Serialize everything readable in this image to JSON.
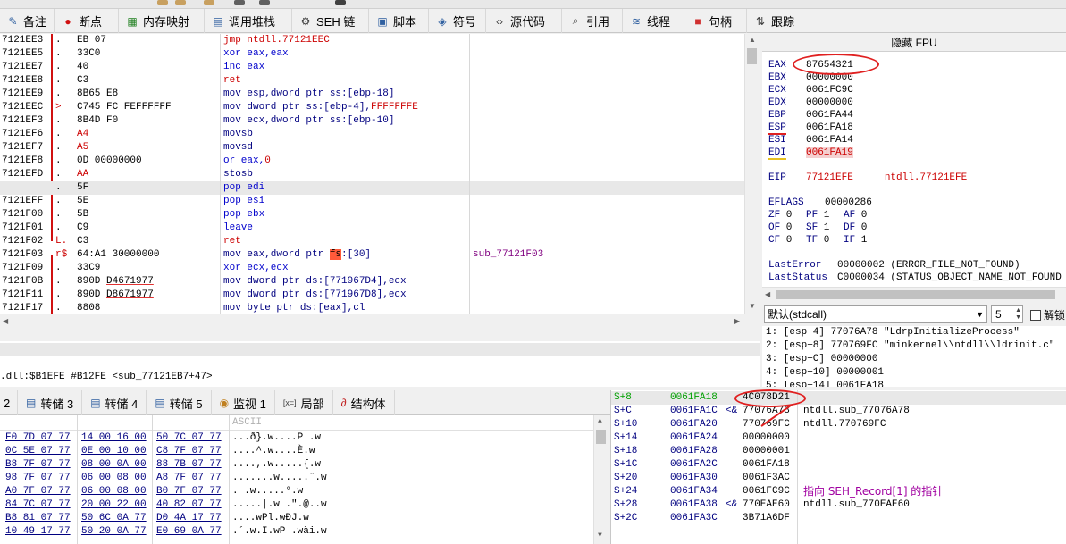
{
  "tabs": [
    {
      "label": "备注",
      "icon": "notes-icon"
    },
    {
      "label": "断点",
      "icon": "breakpoint-icon"
    },
    {
      "label": "内存映射",
      "icon": "memory-map-icon"
    },
    {
      "label": "调用堆栈",
      "icon": "call-stack-icon"
    },
    {
      "label": "SEH 链",
      "icon": "seh-chain-icon"
    },
    {
      "label": "脚本",
      "icon": "script-icon"
    },
    {
      "label": "符号",
      "icon": "symbols-icon"
    },
    {
      "label": "源代码",
      "icon": "source-code-icon"
    },
    {
      "label": "引用",
      "icon": "references-icon"
    },
    {
      "label": "线程",
      "icon": "threads-icon"
    },
    {
      "label": "句柄",
      "icon": "handles-icon"
    },
    {
      "label": "跟踪",
      "icon": "trace-icon"
    }
  ],
  "disasm": {
    "rows": [
      {
        "addr": "7121EE3",
        "mark": ".",
        "bytes": "EB 07",
        "instr": "jmp ntdll.77121EEC",
        "kind": "jmp"
      },
      {
        "addr": "7121EE5",
        "mark": ".",
        "bytes": "33C0",
        "instr": "xor eax,eax",
        "kind": "kw"
      },
      {
        "addr": "7121EE7",
        "mark": ".",
        "bytes": "40",
        "instr": "inc eax",
        "kind": "kw"
      },
      {
        "addr": "7121EE8",
        "mark": ".",
        "bytes": "C3",
        "instr": "ret",
        "kind": "ret"
      },
      {
        "addr": "7121EE9",
        "mark": ".",
        "bytes": "8B65 E8",
        "instr": "mov esp,dword ptr ss:[ebp-18]",
        "kind": "mv"
      },
      {
        "addr": "7121EEC",
        "mark": ">",
        "bytes": "C745 FC FEFFFFFF",
        "instr_parts": [
          "mov dword ptr ss:[ebp-4],",
          "FFFFFFFE"
        ],
        "kind": "mv"
      },
      {
        "addr": "7121EF3",
        "mark": ".",
        "bytes": "8B4D F0",
        "instr": "mov ecx,dword ptr ss:[ebp-10]",
        "kind": "mv"
      },
      {
        "addr": "7121EF6",
        "mark": ".",
        "bytes": "A4",
        "instr": "movsb",
        "kind": "mv",
        "bytes_red": true
      },
      {
        "addr": "7121EF7",
        "mark": ".",
        "bytes": "A5",
        "instr": "movsd",
        "kind": "mv",
        "bytes_red": true
      },
      {
        "addr": "7121EF8",
        "mark": ".",
        "bytes": "0D 00000000",
        "instr_parts": [
          "or eax,",
          "0"
        ],
        "kind": "kw"
      },
      {
        "addr": "7121EFD",
        "mark": ".",
        "bytes": "AA",
        "instr": "stosb",
        "kind": "mv",
        "bytes_red": true
      },
      {
        "addr": "7121EFE",
        "mark": ".",
        "bytes": "5F",
        "instr": "pop edi",
        "kind": "kw",
        "current": true
      },
      {
        "addr": "7121EFF",
        "mark": ".",
        "bytes": "5E",
        "instr": "pop esi",
        "kind": "kw"
      },
      {
        "addr": "7121F00",
        "mark": ".",
        "bytes": "5B",
        "instr": "pop ebx",
        "kind": "kw"
      },
      {
        "addr": "7121F01",
        "mark": ".",
        "bytes": "C9",
        "instr": "leave",
        "kind": "kw"
      },
      {
        "addr": "7121F02",
        "mark": "L.",
        "bytes": "C3",
        "instr": "ret",
        "kind": "ret"
      },
      {
        "addr": "7121F03",
        "mark": "r$",
        "bytes": "64:A1 30000000",
        "instr_parts": [
          "mov eax,dword ptr ",
          "fs",
          ":[30]"
        ],
        "kind": "mv",
        "comment": "sub_77121F03"
      },
      {
        "addr": "7121F09",
        "mark": ".",
        "bytes": "33C9",
        "instr": "xor ecx,ecx",
        "kind": "kw"
      },
      {
        "addr": "7121F0B",
        "mark": ".",
        "bytes_parts": [
          "890D ",
          "D4671977"
        ],
        "instr": "mov dword ptr ds:[771967D4],ecx",
        "kind": "mv"
      },
      {
        "addr": "7121F11",
        "mark": ".",
        "bytes_parts": [
          "890D ",
          "D8671977"
        ],
        "instr": "mov dword ptr ds:[771967D8],ecx",
        "kind": "mv"
      },
      {
        "addr": "7121F17",
        "mark": ".",
        "bytes": "8808",
        "instr": "mov byte ptr ds:[eax],cl",
        "kind": "mv"
      }
    ]
  },
  "registers": {
    "header": "隐藏 FPU",
    "gp": [
      {
        "name": "EAX",
        "value": "87654321"
      },
      {
        "name": "EBX",
        "value": "00000000"
      },
      {
        "name": "ECX",
        "value": "0061FC9C"
      },
      {
        "name": "EDX",
        "value": "00000000"
      },
      {
        "name": "EBP",
        "value": "0061FA44"
      },
      {
        "name": "ESP",
        "value": "0061FA18"
      },
      {
        "name": "ESI",
        "value": "0061FA14"
      },
      {
        "name": "EDI",
        "value": "0061FA19"
      }
    ],
    "eip": {
      "name": "EIP",
      "value": "77121EFE",
      "label": "ntdll.77121EFE"
    },
    "eflags": {
      "name": "EFLAGS",
      "value": "00000286"
    },
    "flags": [
      [
        "ZF 0",
        "PF 1",
        "AF 0"
      ],
      [
        "OF 0",
        "SF 1",
        "DF 0"
      ],
      [
        "CF 0",
        "TF 0",
        "IF 1"
      ]
    ],
    "last_error": {
      "name": "LastError",
      "value": "00000002 (ERROR_FILE_NOT_FOUND)"
    },
    "last_status": {
      "name": "LastStatus",
      "value": "C0000034 (STATUS_OBJECT_NAME_NOT_FOUND)"
    }
  },
  "callconv": {
    "selected": "默认(stdcall)",
    "arg_count": "5",
    "unlock_label": "解锁"
  },
  "args": [
    "1: [esp+4] 77076A78 \"LdrpInitializeProcess\"",
    "2: [esp+8] 770769FC \"minkernel\\\\ntdll\\\\ldrinit.c\"",
    "3: [esp+C] 00000000",
    "4: [esp+10] 00000001",
    "5: [esp+14] 0061FA18"
  ],
  "info": {
    "text": ".dll:$B1EFE #B12FE <sub_77121EB7+47>"
  },
  "dump_tabs": [
    {
      "label": "2",
      "icon": ""
    },
    {
      "label": "转储 3",
      "icon": "dump-icon"
    },
    {
      "label": "转储 4",
      "icon": "dump-icon"
    },
    {
      "label": "转储 5",
      "icon": "dump-icon"
    },
    {
      "label": "监视 1",
      "icon": "watch-icon"
    },
    {
      "label": "局部",
      "icon": "locals-icon"
    },
    {
      "label": "结构体",
      "icon": "struct-icon"
    }
  ],
  "dump": {
    "ascii_header": "ASCII",
    "rows": [
      {
        "g1": "F0 7D 07 77",
        "g2": "14 00 16 00",
        "g3": "50 7C 07 77",
        "ascii": "...ð}.w....P|.w"
      },
      {
        "g1": "0C 5E 07 77",
        "g2": "0E 00 10 00",
        "g3": "C8 7F 07 77",
        "ascii": "....^.w....È.w"
      },
      {
        "g1": "B8 7F 07 77",
        "g2": "08 00 0A 00",
        "g3": "88 7B 07 77",
        "ascii": "....,.w.....{.w"
      },
      {
        "g1": "98 7F 07 77",
        "g2": "06 00 08 00",
        "g3": "A8 7F 07 77",
        "ascii": ".......w.....¨.w"
      },
      {
        "g1": "A0 7F 07 77",
        "g2": "06 00 08 00",
        "g3": "B0 7F 07 77",
        "ascii": ". .w.....°.w"
      },
      {
        "g1": "84 7C 07 77",
        "g2": "20 00 22 00",
        "g3": "40 82 07 77",
        "ascii": ".....|.w .\".@..w"
      },
      {
        "g1": "B8 81 07 77",
        "g2": "50 6C 0A 77",
        "g3": "D0 4A 17 77",
        "ascii": "....wPl.wÐJ.w"
      },
      {
        "g1": "10 49 17 77",
        "g2": "50 20 0A 77",
        "g3": "E0 69 0A 77",
        "ascii": ".´.w.I.wP .wài.w"
      }
    ]
  },
  "stack": {
    "rows": [
      {
        "off": "$+8",
        "addr": "0061FA18",
        "val": "4C078D21",
        "cmt": "",
        "top": true
      },
      {
        "off": "$+C",
        "addr": "0061FA1C",
        "bracket": "<&",
        "val": "77076A78",
        "cmt": "ntdll.sub_77076A78"
      },
      {
        "off": "$+10",
        "addr": "0061FA20",
        "val": "770769FC",
        "cmt": "ntdll.770769FC"
      },
      {
        "off": "$+14",
        "addr": "0061FA24",
        "val": "00000000",
        "cmt": ""
      },
      {
        "off": "$+18",
        "addr": "0061FA28",
        "val": "00000001",
        "cmt": ""
      },
      {
        "off": "$+1C",
        "addr": "0061FA2C",
        "val": "0061FA18",
        "cmt": ""
      },
      {
        "off": "$+20",
        "addr": "0061FA30",
        "val": "0061F3AC",
        "cmt": ""
      },
      {
        "off": "$+24",
        "addr": "0061FA34",
        "val": "0061FC9C",
        "cmt": "指向 SEH_Record[1] 的指针",
        "purple": true
      },
      {
        "off": "$+28",
        "addr": "0061FA38",
        "bracket": "<&",
        "val": "770EAE60",
        "cmt": "ntdll.sub_770EAE60"
      },
      {
        "off": "$+2C",
        "addr": "0061FA3C",
        "val": "3B71A6DF",
        "cmt": ""
      }
    ]
  },
  "colors": {
    "accent_red": "#e02020",
    "current_line_green": "#3cd83c",
    "register_blue": "#000080"
  }
}
